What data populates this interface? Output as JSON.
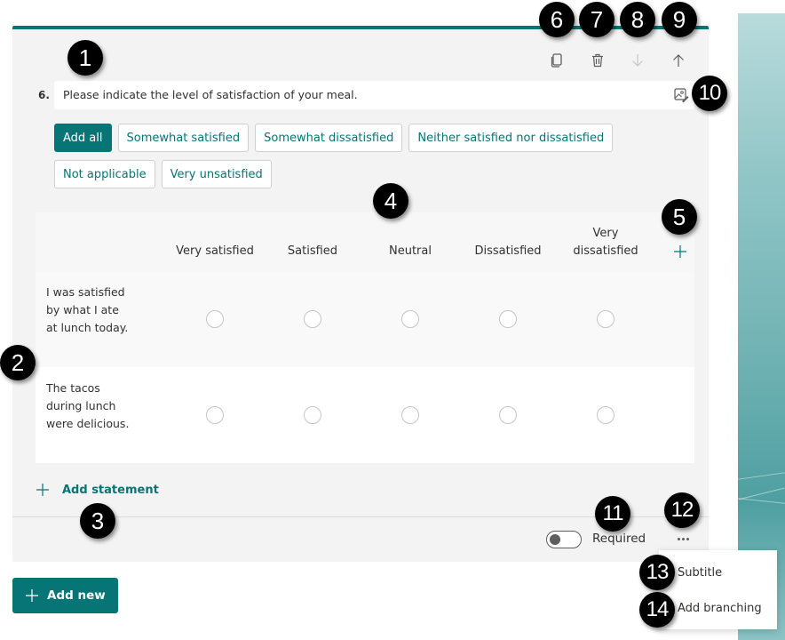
{
  "question": {
    "number": "6.",
    "title": "Please indicate the level of satisfaction of your meal.",
    "accent_color": "#077575"
  },
  "toolbar": {
    "copy_icon": "copy-icon",
    "delete_icon": "trash-icon",
    "move_down_icon": "arrow-down-icon",
    "move_up_icon": "arrow-up-icon",
    "media_icon": "insert-media-icon"
  },
  "suggestions": {
    "add_all": "Add all",
    "options": [
      "Somewhat satisfied",
      "Somewhat dissatisfied",
      "Neither satisfied nor dissatisfied",
      "Not applicable",
      "Very unsatisfied"
    ]
  },
  "grid": {
    "columns": [
      "Very satisfied",
      "Satisfied",
      "Neutral",
      "Dissatisfied",
      "Very dissatisfied"
    ],
    "rows": [
      {
        "statement": "I was satisfied by what I ate at lunch today."
      },
      {
        "statement": "The tacos during lunch were delicious."
      }
    ],
    "add_column_icon": "plus-icon"
  },
  "add_statement_label": "Add statement",
  "required": {
    "label": "Required",
    "on": false
  },
  "more_menu": {
    "items": [
      "Subtitle",
      "Add branching"
    ]
  },
  "add_new_label": "Add new",
  "callouts": [
    "1",
    "2",
    "3",
    "4",
    "5",
    "6",
    "7",
    "8",
    "9",
    "10",
    "11",
    "12",
    "13",
    "14"
  ]
}
